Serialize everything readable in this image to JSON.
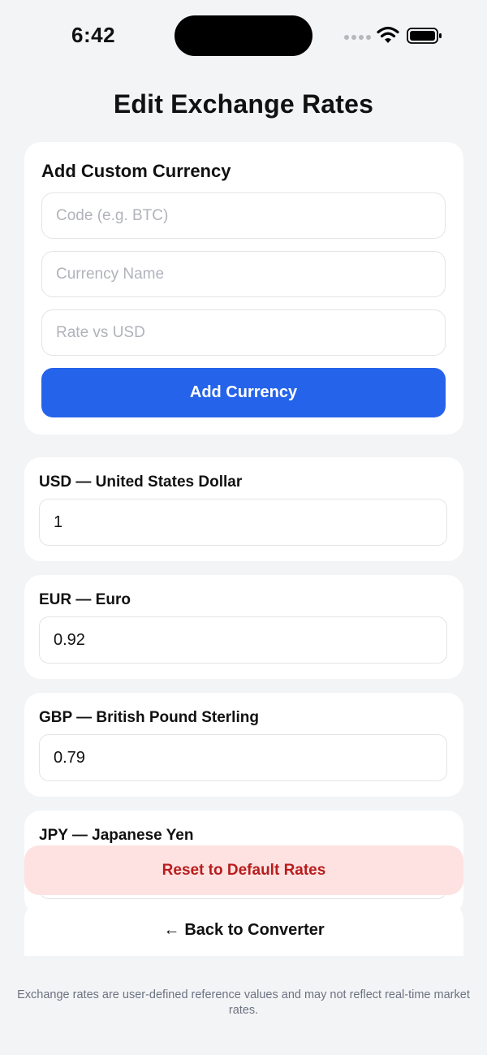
{
  "status_bar": {
    "time": "6:42"
  },
  "page": {
    "title": "Edit Exchange Rates"
  },
  "add_custom": {
    "title": "Add Custom Currency",
    "code_placeholder": "Code (e.g. BTC)",
    "name_placeholder": "Currency Name",
    "rate_placeholder": "Rate vs USD",
    "button_label": "Add Currency"
  },
  "rates": [
    {
      "label": "USD — United States Dollar",
      "value": "1"
    },
    {
      "label": "EUR — Euro",
      "value": "0.92"
    },
    {
      "label": "GBP — British Pound Sterling",
      "value": "0.79"
    },
    {
      "label": "JPY — Japanese Yen",
      "value": ""
    }
  ],
  "actions": {
    "reset_label": "Reset to Default Rates",
    "back_arrow": "←",
    "back_label": "Back to Converter"
  },
  "footer": {
    "note": "Exchange rates are user-defined reference values and may not reflect real-time market rates."
  },
  "icons": {
    "signal": "signal-dots-icon",
    "wifi": "wifi-icon",
    "battery": "battery-icon"
  },
  "colors": {
    "accent": "#2563eb",
    "reset_bg": "#fee2e2",
    "reset_text": "#b91c1c",
    "page_bg": "#f3f4f6"
  }
}
